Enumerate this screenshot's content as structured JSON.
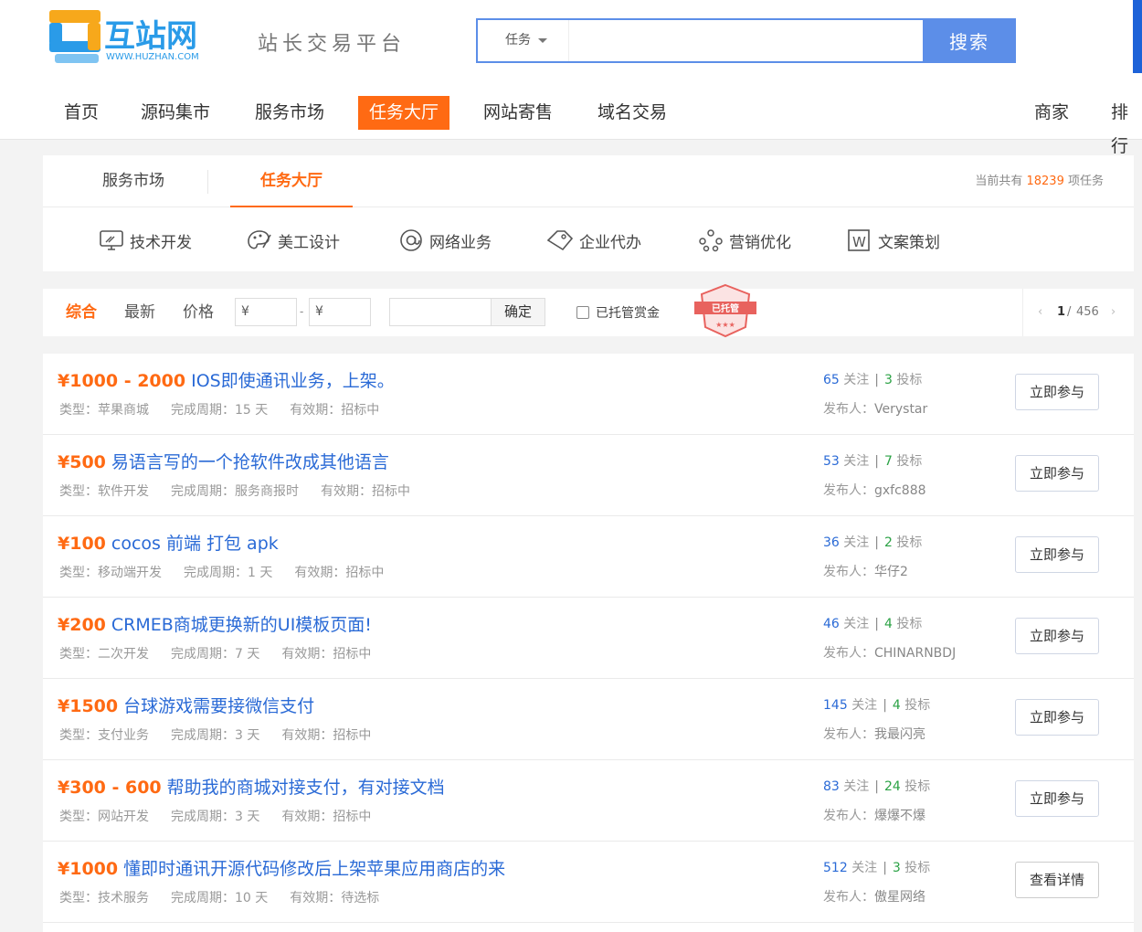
{
  "header": {
    "logo_text": "互站网",
    "logo_url_text": "WWW.HUZHAN.COM",
    "slogan": "站长交易平台",
    "search": {
      "category": "任务",
      "placeholder": "",
      "button": "搜索"
    }
  },
  "nav": {
    "items": [
      {
        "label": "首页",
        "active": false
      },
      {
        "label": "源码集市",
        "active": false
      },
      {
        "label": "服务市场",
        "active": false
      },
      {
        "label": "任务大厅",
        "active": true
      },
      {
        "label": "网站寄售",
        "active": false
      },
      {
        "label": "域名交易",
        "active": false
      },
      {
        "label": "商家",
        "active": false
      },
      {
        "label": "排行",
        "active": false
      }
    ]
  },
  "tabs": {
    "items": [
      "服务市场",
      "任务大厅"
    ],
    "count_prefix": "当前共有",
    "count_value": "18239",
    "count_suffix": "项任务"
  },
  "categories": [
    {
      "label": "技术开发",
      "icon": "monitor-icon"
    },
    {
      "label": "美工设计",
      "icon": "palette-icon"
    },
    {
      "label": "网络业务",
      "icon": "at-icon"
    },
    {
      "label": "企业代办",
      "icon": "tag-icon"
    },
    {
      "label": "营销优化",
      "icon": "network-icon"
    },
    {
      "label": "文案策划",
      "icon": "document-w-icon"
    }
  ],
  "filter": {
    "sorts": [
      "综合",
      "最新",
      "价格"
    ],
    "price_min": "¥",
    "price_dash": "-",
    "price_max": "¥",
    "confirm": "确定",
    "escrow_label": "已托管赏金",
    "badge_text": "已托管",
    "pager": {
      "prev": "‹",
      "current": "1",
      "sep": "/",
      "total": "456",
      "next": "›"
    }
  },
  "tasks": [
    {
      "price": "¥1000 - 2000",
      "title": "IOS即使通讯业务，上架。",
      "type": "类型：苹果商城",
      "period": "完成周期：15 天",
      "validity": "有效期：招标中",
      "follows": "65",
      "follow_label": "关注",
      "sep": "|",
      "bids": "3",
      "bid_label": "投标",
      "author_label": "发布人：",
      "author": "Verystar",
      "button": "立即参与"
    },
    {
      "price": "¥500",
      "title": "易语言写的一个抢软件改成其他语言",
      "type": "类型：软件开发",
      "period": "完成周期：服务商报时",
      "validity": "有效期：招标中",
      "follows": "53",
      "follow_label": "关注",
      "sep": "|",
      "bids": "7",
      "bid_label": "投标",
      "author_label": "发布人：",
      "author": "gxfc888",
      "button": "立即参与"
    },
    {
      "price": "¥100",
      "title": "cocos 前端 打包 apk",
      "type": "类型：移动端开发",
      "period": "完成周期：1 天",
      "validity": "有效期：招标中",
      "follows": "36",
      "follow_label": "关注",
      "sep": "|",
      "bids": "2",
      "bid_label": "投标",
      "author_label": "发布人：",
      "author": "华仔2",
      "button": "立即参与"
    },
    {
      "price": "¥200",
      "title": "CRMEB商城更换新的UI模板页面!",
      "type": "类型：二次开发",
      "period": "完成周期：7 天",
      "validity": "有效期：招标中",
      "follows": "46",
      "follow_label": "关注",
      "sep": "|",
      "bids": "4",
      "bid_label": "投标",
      "author_label": "发布人：",
      "author": "CHINARNBDJ",
      "button": "立即参与"
    },
    {
      "price": "¥1500",
      "title": "台球游戏需要接微信支付",
      "type": "类型：支付业务",
      "period": "完成周期：3 天",
      "validity": "有效期：招标中",
      "follows": "145",
      "follow_label": "关注",
      "sep": "|",
      "bids": "4",
      "bid_label": "投标",
      "author_label": "发布人：",
      "author": "我最闪亮",
      "button": "立即参与"
    },
    {
      "price": "¥300 - 600",
      "title": "帮助我的商城对接支付，有对接文档",
      "type": "类型：网站开发",
      "period": "完成周期：3 天",
      "validity": "有效期：招标中",
      "follows": "83",
      "follow_label": "关注",
      "sep": "|",
      "bids": "24",
      "bid_label": "投标",
      "author_label": "发布人：",
      "author": "爆爆不爆",
      "button": "立即参与"
    },
    {
      "price": "¥1000",
      "title": "懂即时通讯开源代码修改后上架苹果应用商店的来",
      "type": "类型：技术服务",
      "period": "完成周期：10 天",
      "validity": "有效期：待选标",
      "follows": "512",
      "follow_label": "关注",
      "sep": "|",
      "bids": "3",
      "bid_label": "投标",
      "author_label": "发布人：",
      "author": "傲星网络",
      "button": "查看详情"
    }
  ],
  "colors": {
    "accent": "#ff6a13",
    "link": "#2a6ad6",
    "search": "#5c8ee8",
    "bid": "#2ba245"
  }
}
